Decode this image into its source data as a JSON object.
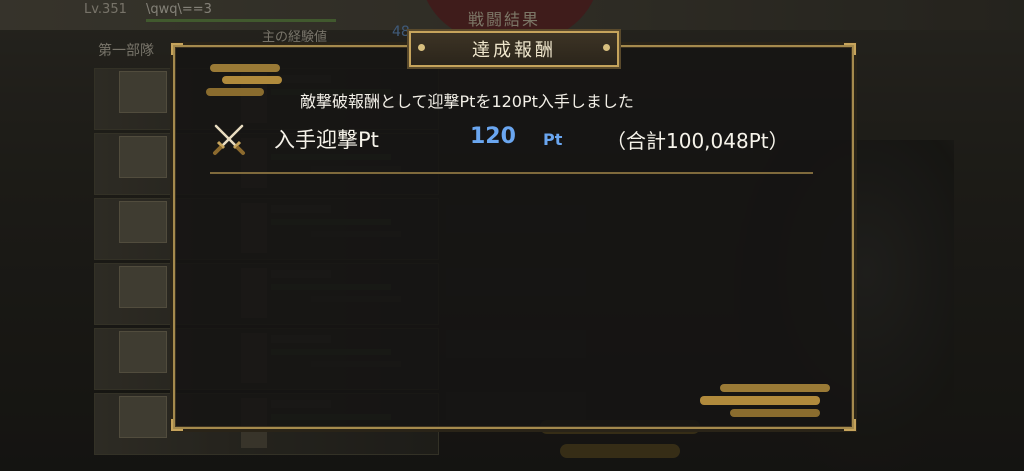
{
  "background": {
    "level": "Lv.351",
    "user_name": "\\qwq\\==3",
    "screen_title": "戦闘結果",
    "unit_label": "第一部隊",
    "xp_label": "主の経験値",
    "xp_value": "48"
  },
  "dialog": {
    "title": "達成報酬",
    "message": "敵撃破報酬として迎撃Ptを120Pt入手しました",
    "reward_label": "入手迎撃Pt",
    "reward_amount": "120",
    "reward_unit": "Pt",
    "reward_total": "（合計100,048Pt）",
    "icon": "crossed-swords-icon"
  },
  "colors": {
    "accent_gold": "#c6a45c",
    "amount_blue": "#6aa6f0"
  }
}
